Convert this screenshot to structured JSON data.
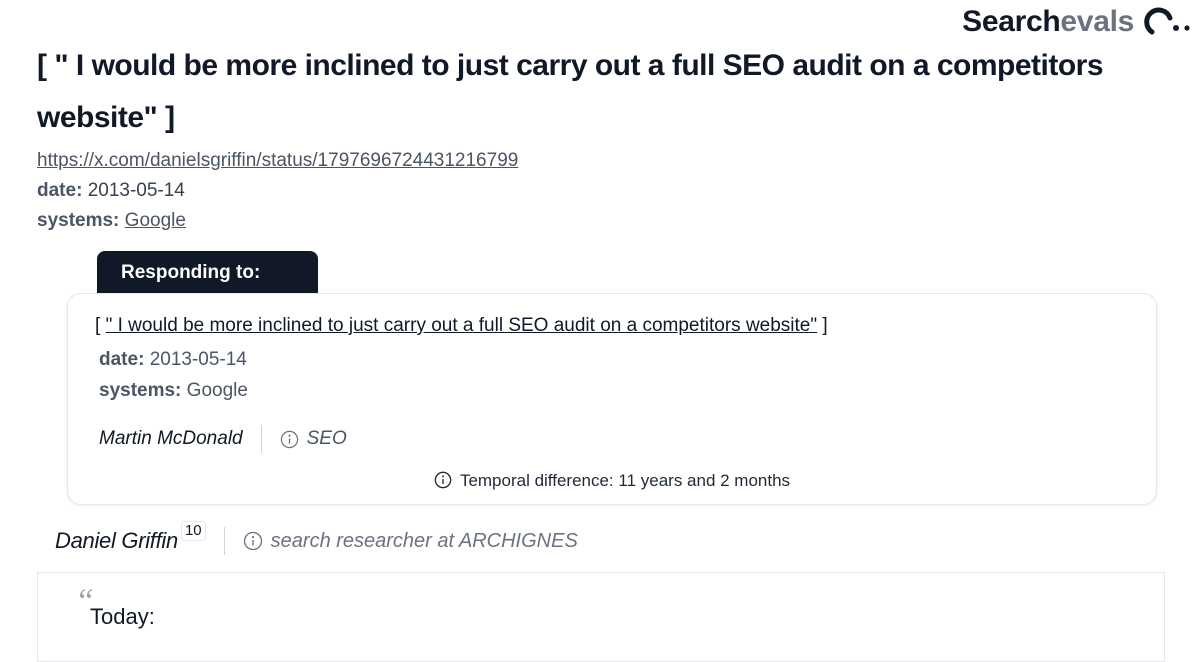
{
  "brand": {
    "part1": "Search",
    "part2": "evals",
    "logo_icon": "searchevals-logo-icon"
  },
  "title": {
    "open": "[",
    "text": "\" I would be more inclined to just carry out a full SEO audit on a competitors website\"",
    "close": "]"
  },
  "meta": {
    "url": "https://x.com/danielsgriffin/status/1797696724431216799",
    "date_label": "date:",
    "date_value": "2013-05-14",
    "systems_label": "systems:",
    "systems_value": "Google"
  },
  "responding": {
    "tab_label": "Responding to:",
    "quote_open": "[",
    "quote_text": "\" I would be more inclined to just carry out a full SEO audit on a competitors website\"",
    "quote_close": "]",
    "date_label": "date:",
    "date_value": "2013-05-14",
    "systems_label": "systems:",
    "systems_value": "Google",
    "author": "Martin McDonald",
    "tag": "SEO",
    "temporal": "Temporal difference: 11 years and 2 months"
  },
  "author": {
    "name": "Daniel Griffin",
    "count": "10",
    "tag": "search researcher at ARCHIGNES"
  },
  "post": {
    "quote_mark": "“",
    "text": "Today:"
  },
  "colors": {
    "dark": "#111827",
    "muted": "#6b7280",
    "border": "#e5e7eb"
  }
}
